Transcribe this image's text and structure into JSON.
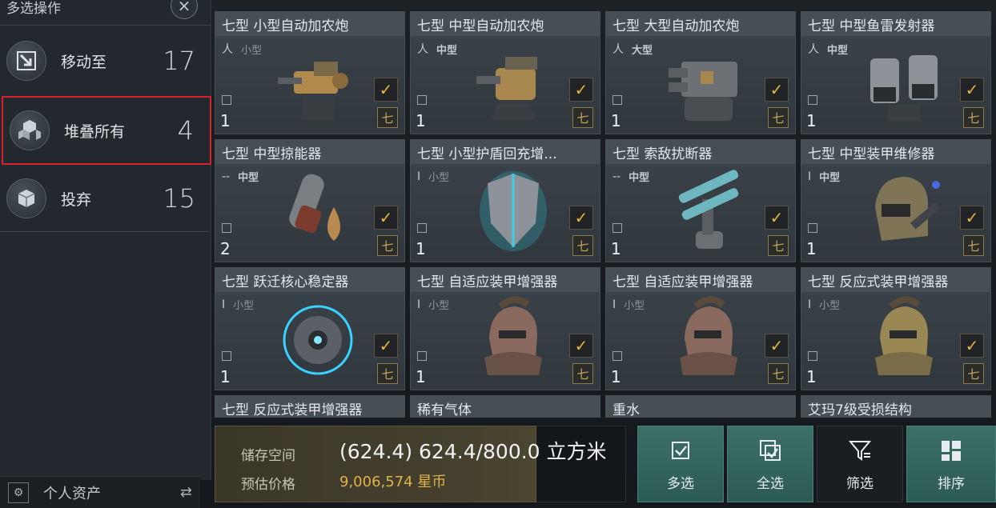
{
  "panel": {
    "title": "多选操作",
    "close_label": "×",
    "actions": [
      {
        "label": "移动至",
        "count": "17"
      },
      {
        "label": "堆叠所有",
        "count": "4"
      },
      {
        "label": "投弃",
        "count": "15"
      }
    ],
    "footer_label": "个人资产",
    "footer_swap": "⇄"
  },
  "cards": [
    {
      "name": "七型 小型自动加农炮",
      "size_label": "小型",
      "qty": "1",
      "tier": "七",
      "check": "✓",
      "size_icon": "人",
      "art": "gun-small"
    },
    {
      "name": "七型 中型自动加农炮",
      "size_label": "中型",
      "qty": "1",
      "tier": "七",
      "check": "✓",
      "size_icon": "人",
      "art": "gun-medium"
    },
    {
      "name": "七型 大型自动加农炮",
      "size_label": "大型",
      "qty": "1",
      "tier": "七",
      "check": "✓",
      "size_icon": "人",
      "art": "gun-large"
    },
    {
      "name": "七型 中型鱼雷发射器",
      "size_label": "中型",
      "qty": "1",
      "tier": "七",
      "check": "✓",
      "size_icon": "人",
      "art": "torpedo"
    },
    {
      "name": "七型 中型掠能器",
      "size_label": "中型",
      "qty": "2",
      "tier": "七",
      "check": "✓",
      "size_icon": "--",
      "art": "capsule"
    },
    {
      "name": "七型 小型护盾回充增...",
      "size_label": "小型",
      "qty": "1",
      "tier": "七",
      "check": "✓",
      "size_icon": "I",
      "art": "shield"
    },
    {
      "name": "七型 索敌扰断器",
      "size_label": "中型",
      "qty": "1",
      "tier": "七",
      "check": "✓",
      "size_icon": "--",
      "art": "jammer"
    },
    {
      "name": "七型 中型装甲维修器",
      "size_label": "中型",
      "qty": "1",
      "tier": "七",
      "check": "✓",
      "size_icon": "I",
      "art": "helmet"
    },
    {
      "name": "七型 跃迁核心稳定器",
      "size_label": "小型",
      "qty": "1",
      "tier": "七",
      "check": "✓",
      "size_icon": "I",
      "art": "core"
    },
    {
      "name": "七型 自适应装甲增强器",
      "size_label": "小型",
      "qty": "1",
      "tier": "七",
      "check": "✓",
      "size_icon": "I",
      "art": "armor-red"
    },
    {
      "name": "七型 自适应装甲增强器",
      "size_label": "小型",
      "qty": "1",
      "tier": "七",
      "check": "✓",
      "size_icon": "I",
      "art": "armor-red"
    },
    {
      "name": "七型 反应式装甲增强器",
      "size_label": "小型",
      "qty": "1",
      "tier": "七",
      "check": "✓",
      "size_icon": "I",
      "art": "armor-gold"
    },
    {
      "name": "七型 反应式装甲增强器"
    },
    {
      "name": "稀有气体"
    },
    {
      "name": "重水"
    },
    {
      "name": "艾玛7级受损结构"
    }
  ],
  "storage": {
    "space_label": "储存空间",
    "price_label": "预估价格",
    "capacity": "(624.4) 624.4/800.0 立方米",
    "price": "9,006,574 星币"
  },
  "buttons": [
    {
      "label": "多选",
      "icon": "check-square-icon"
    },
    {
      "label": "全选",
      "icon": "select-all-icon"
    },
    {
      "label": "筛选",
      "icon": "filter-icon"
    },
    {
      "label": "排序",
      "icon": "sort-icon"
    }
  ],
  "colors": {
    "accent_gold": "#e8b33a",
    "teal": "#3d7069",
    "highlight_red": "#d8202a"
  }
}
